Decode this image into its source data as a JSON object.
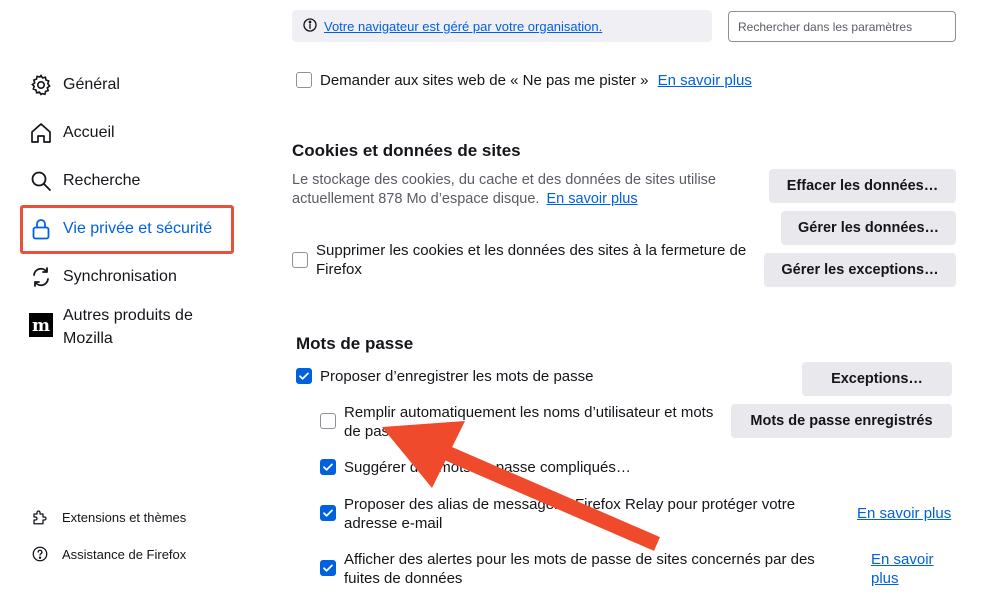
{
  "sidebar": {
    "items": [
      {
        "label": "Général",
        "icon": "gear-icon"
      },
      {
        "label": "Accueil",
        "icon": "home-icon"
      },
      {
        "label": "Recherche",
        "icon": "search-icon"
      },
      {
        "label": "Vie privée et sécurité",
        "icon": "lock-icon",
        "selected": true
      },
      {
        "label": "Synchronisation",
        "icon": "sync-icon"
      },
      {
        "label": "Autres produits de Mozilla",
        "icon": "mozilla-icon"
      }
    ],
    "footer": [
      {
        "label": "Extensions et thèmes",
        "icon": "puzzle-icon"
      },
      {
        "label": "Assistance de Firefox",
        "icon": "help-icon"
      }
    ]
  },
  "banner": {
    "text": "Votre navigateur est géré par votre organisation.",
    "icon": "info-icon"
  },
  "search": {
    "placeholder": "Rechercher dans les paramètres"
  },
  "dnt": {
    "label": "Demander aux sites web de « Ne pas me pister »",
    "link": "En savoir plus",
    "checked": false
  },
  "cookies": {
    "title": "Cookies et données de sites",
    "desc_line1": "Le stockage des cookies, du cache et des données de sites utilise",
    "desc_line2": "actuellement 878 Mo d’espace disque.",
    "link": "En savoir plus",
    "clear_button": "Effacer les données…",
    "manage_button": "Gérer les données…",
    "exceptions_button": "Gérer les exceptions…",
    "delete_on_close_line1": "Supprimer les cookies et les données des sites à la fermeture de",
    "delete_on_close_line2": "Firefox",
    "delete_on_close_checked": false
  },
  "passwords": {
    "title": "Mots de passe",
    "offer_save": {
      "label": "Proposer d’enregistrer les mots de passe",
      "checked": true
    },
    "exceptions_button": "Exceptions…",
    "autofill": {
      "line1": "Remplir automatiquement les noms d’utilisateur et mots",
      "line2": "de passe",
      "checked": false
    },
    "saved_button": "Mots de passe enregistrés",
    "suggest": {
      "label": "Suggérer des mots de passe compliqués…",
      "checked": true
    },
    "relay": {
      "line1": "Proposer des alias de messagerie Firefox Relay pour protéger votre",
      "line2": "adresse e-mail",
      "link": "En savoir plus",
      "checked": true
    },
    "breach": {
      "line1": "Afficher des alertes pour les mots de passe de sites concernés par des",
      "line2": "fuites de données",
      "link_line1": "En savoir",
      "link_line2": "plus",
      "checked": true
    }
  },
  "colors": {
    "accent": "#0061e0",
    "highlight": "#e8503a",
    "arrow": "#f04a2c"
  }
}
